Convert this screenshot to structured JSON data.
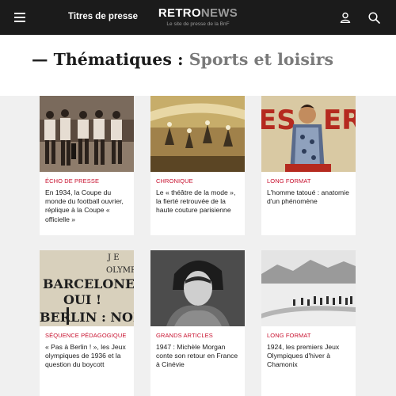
{
  "header": {
    "nav_link": "Titres de presse",
    "logo_retro": "RETRO",
    "logo_news": "NEWS",
    "logo_tagline": "Le site de presse de la BnF",
    "icons": [
      "menu-icon",
      "user-icon",
      "search-icon"
    ]
  },
  "page": {
    "title_prefix": "— Thématiques : ",
    "title_accent": "Sports et loisirs"
  },
  "cards": [
    {
      "category": "Écho de presse",
      "title": "En 1934, la Coupe du monde du football ouvrier, réplique à la Coupe « officielle »"
    },
    {
      "category": "Chronique",
      "title": "Le « théâtre de la mode », la fierté retrouvée de la haute couture parisienne"
    },
    {
      "category": "Long format",
      "title": "L'homme tatoué : anatomie d'un phénomène"
    },
    {
      "category": "Séquence pédagogique",
      "title": "« Pas à Berlin ! », les Jeux olympiques de 1936 et la question du boycott"
    },
    {
      "category": "Grands articles",
      "title": "1947 : Michèle Morgan conte son retour en France à Cinévie"
    },
    {
      "category": "Long format",
      "title": "1924, les premiers Jeux Olympiques d'hiver à Chamonix"
    }
  ],
  "colors": {
    "header_bg": "#1b1b1b",
    "accent_red": "#c8102e",
    "page_bg": "#f0f0f0"
  }
}
